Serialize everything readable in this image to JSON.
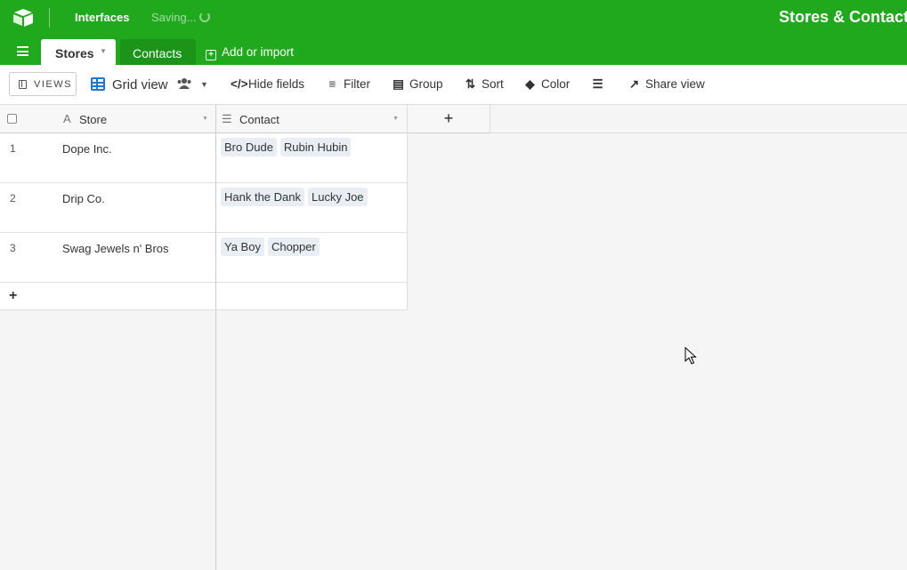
{
  "topbar": {
    "logo_icon": "airtable-logo-icon",
    "interfaces_label": "Interfaces",
    "saving_label": "Saving...",
    "base_title": "Stores & Contacts",
    "bg_color": "#20a91d"
  },
  "tabs": {
    "menu_icon": "hamburger-icon",
    "active": "Stores",
    "other": "Contacts",
    "add_import": "Add or import"
  },
  "toolbar": {
    "views_label": "VIEWS",
    "view_name": "Grid view",
    "hide_fields": "Hide fields",
    "filter": "Filter",
    "group": "Group",
    "sort": "Sort",
    "color": "Color",
    "share_view": "Share view"
  },
  "grid": {
    "columns": [
      {
        "name": "Store",
        "icon": "text-field-icon"
      },
      {
        "name": "Contact",
        "icon": "linked-record-icon"
      }
    ],
    "add_column_label": "+",
    "add_row_label": "+",
    "rows": [
      {
        "num": "1",
        "store": "Dope Inc.",
        "contacts": [
          "Bro Dude",
          "Rubin Hubin"
        ]
      },
      {
        "num": "2",
        "store": "Drip Co.",
        "contacts": [
          "Hank the Dank",
          "Lucky Joe"
        ]
      },
      {
        "num": "3",
        "store": "Swag Jewels n' Bros",
        "contacts": [
          "Ya Boy",
          "Chopper"
        ]
      }
    ]
  }
}
